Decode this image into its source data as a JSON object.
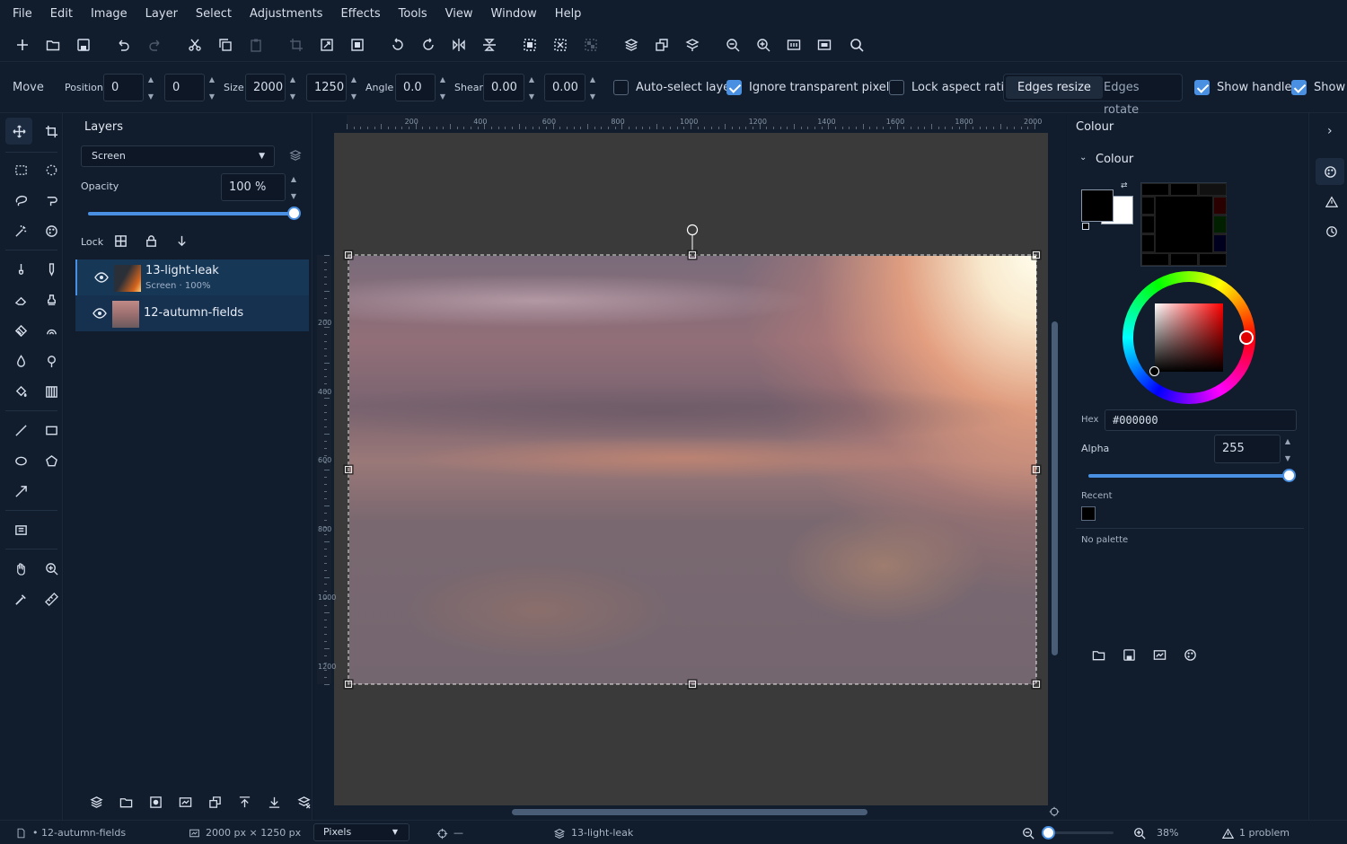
{
  "menu": [
    "File",
    "Edit",
    "Image",
    "Layer",
    "Select",
    "Adjustments",
    "Effects",
    "Tools",
    "View",
    "Window",
    "Help"
  ],
  "toolbar_icons": [
    "new-icon",
    "open-icon",
    "save-icon",
    "undo-icon",
    "redo-icon",
    "cut-icon",
    "copy-icon",
    "paste-icon",
    "crop-icon",
    "resize-image-icon",
    "resize-canvas-icon",
    "rotate-left-icon",
    "rotate-right-icon",
    "flip-horizontal-icon",
    "flip-vertical-icon",
    "select-all-icon",
    "deselect-icon",
    "invert-selection-icon",
    "add-layer-icon",
    "duplicate-layer-icon",
    "merge-layer-icon",
    "zoom-out-icon",
    "zoom-in-icon",
    "actual-size-icon",
    "best-fit-icon",
    "search-icon"
  ],
  "options": {
    "tool_name": "Move",
    "position_label": "Position",
    "position_x": "0",
    "position_y": "0",
    "size_label": "Size",
    "size_w": "2000",
    "size_h": "1250",
    "angle_label": "Angle",
    "angle": "0.0",
    "shear_label": "Shear",
    "shear_x": "0.00",
    "shear_y": "0.00",
    "auto_select": {
      "label": "Auto-select layer",
      "checked": false
    },
    "ignore_transparent": {
      "label": "Ignore transparent pixels",
      "checked": true
    },
    "lock_aspect": {
      "label": "Lock aspect ratio",
      "checked": false
    },
    "edges_resize": "Edges resize",
    "edges_rotate": "Edges rotate",
    "show_handles": {
      "label": "Show handles",
      "checked": true
    },
    "show_other": {
      "label": "Show",
      "checked": true
    }
  },
  "layers": {
    "title": "Layers",
    "blend_mode": "Screen",
    "opacity_label": "Opacity",
    "opacity_value": "100 %",
    "opacity": 1.0,
    "lock_label": "Lock",
    "items": [
      {
        "name": "13-light-leak",
        "sub": "Screen · 100%",
        "selected": true
      },
      {
        "name": "12-autumn-fields",
        "sub": "",
        "selected": false
      }
    ]
  },
  "ruler_h": [
    "200",
    "400",
    "600",
    "800",
    "1000",
    "1200",
    "1400",
    "1600",
    "1800",
    "2000"
  ],
  "ruler_v": [
    "200",
    "400",
    "600",
    "800",
    "1000",
    "1200"
  ],
  "colour": {
    "panel_title": "Colour",
    "section_title": "Colour",
    "primary": "#000000",
    "secondary": "#ffffff",
    "hex_label": "Hex",
    "hex_value": "#000000",
    "alpha_label": "Alpha",
    "alpha_value": "255",
    "alpha": 1.0,
    "recent_label": "Recent",
    "no_palette": "No palette"
  },
  "status": {
    "document": "• 12-autumn-fields",
    "dimensions": "2000 px × 1250 px",
    "units": "Pixels",
    "cursor": "—",
    "active_layer": "13-light-leak",
    "zoom": "38%",
    "problems": "1 problem"
  },
  "accent": "#4a90e2"
}
